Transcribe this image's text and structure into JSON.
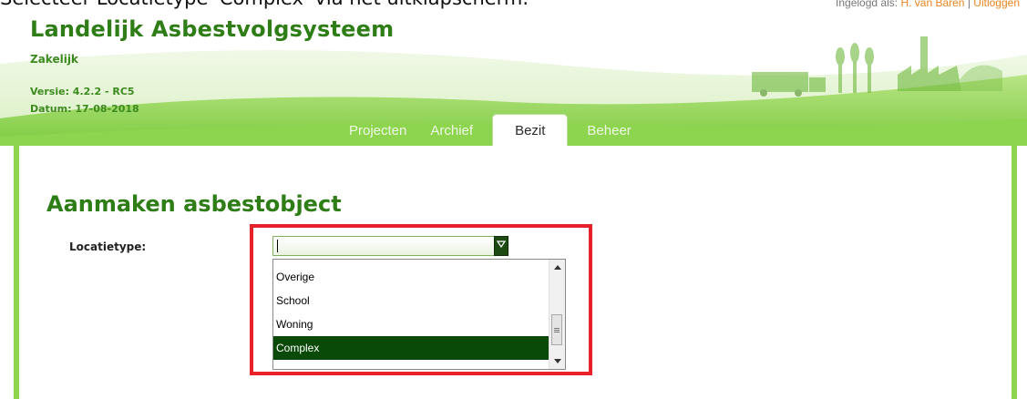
{
  "caption": "Selecteer Locatietype 'Complex' via het uitklapscherm.",
  "login": {
    "prefix": "Ingelogd als:",
    "user": "H. van Baren",
    "separator": "|",
    "logout": "Uitloggen"
  },
  "header": {
    "title": "Landelijk Asbestvolgsysteem",
    "subtitle": "Zakelijk",
    "version": "Versie: 4.2.2 - RC5",
    "date": "Datum: 17-08-2018"
  },
  "tabs": [
    {
      "label": "Projecten",
      "active": false
    },
    {
      "label": "Archief",
      "active": false
    },
    {
      "label": "Bezit",
      "active": true
    },
    {
      "label": "Beheer",
      "active": false
    }
  ],
  "page": {
    "title": "Aanmaken asbestobject"
  },
  "form": {
    "locatietype_label": "Locatietype:",
    "locatietype_value": "",
    "options": [
      "Overige",
      "School",
      "Woning",
      "Complex"
    ],
    "selected_option": "Complex"
  },
  "colors": {
    "brand_green": "#2e7d17",
    "header_green": "#8ed54f",
    "highlight_red": "#e8222a",
    "selected_bg": "#0a4a08",
    "link_orange": "#e8841e"
  },
  "icons": {
    "dropdown_button": "chevron-down-icon",
    "scroll_up": "arrow-up-icon",
    "scroll_down": "arrow-down-icon",
    "scroll_thumb_grip": "grip-icon",
    "header_illustration": "factory-landscape-icon"
  }
}
